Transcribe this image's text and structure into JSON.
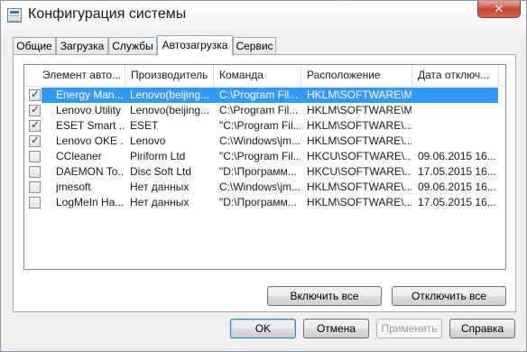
{
  "window": {
    "title": "Конфигурация системы",
    "close_glyph": "✕"
  },
  "tabs": [
    {
      "label": "Общие",
      "active": false
    },
    {
      "label": "Загрузка",
      "active": false
    },
    {
      "label": "Службы",
      "active": false
    },
    {
      "label": "Автозагрузка",
      "active": true
    },
    {
      "label": "Сервис",
      "active": false
    }
  ],
  "startup": {
    "columns": [
      "Элемент авто...",
      "Производитель",
      "Команда",
      "Расположение",
      "Дата отключ..."
    ],
    "rows": [
      {
        "checked": true,
        "selected": true,
        "item": "Energy Man...",
        "vendor": "Lenovo(beijing...",
        "command": "C:\\Program Fil...",
        "location": "HKLM\\SOFTWARE\\M...",
        "date": ""
      },
      {
        "checked": true,
        "selected": false,
        "item": "Lenovo Utility",
        "vendor": "Lenovo(beijing...",
        "command": "C:\\Program Fil...",
        "location": "HKLM\\SOFTWARE\\M...",
        "date": ""
      },
      {
        "checked": true,
        "selected": false,
        "item": "ESET Smart ...",
        "vendor": "ESET",
        "command": "\"C:\\Program Fil...",
        "location": "HKLM\\SOFTWARE\\...",
        "date": ""
      },
      {
        "checked": true,
        "selected": false,
        "item": "Lenovo OKE ...",
        "vendor": "Lenovo",
        "command": "C:\\Windows\\jm...",
        "location": "HKLM\\SOFTWARE\\...",
        "date": ""
      },
      {
        "checked": false,
        "selected": false,
        "item": "CCleaner",
        "vendor": "Piriform Ltd",
        "command": "\"C:\\Program Fil...",
        "location": "HKCU\\SOFTWARE\\...",
        "date": "09.06.2015 16..."
      },
      {
        "checked": false,
        "selected": false,
        "item": "DAEMON To...",
        "vendor": "Disc Soft Ltd",
        "command": "\"D:\\Программ...",
        "location": "HKCU\\SOFTWARE\\...",
        "date": "17.05.2015 16..."
      },
      {
        "checked": false,
        "selected": false,
        "item": "jmesoft",
        "vendor": "Нет данных",
        "command": "C:\\Windows\\jm...",
        "location": "HKLM\\SOFTWARE\\...",
        "date": "09.06.2015 16..."
      },
      {
        "checked": false,
        "selected": false,
        "item": "LogMeIn Ha...",
        "vendor": "Нет данных",
        "command": "\"D:\\Программ...",
        "location": "HKLM\\SOFTWARE\\...",
        "date": "17.05.2015 16..."
      }
    ]
  },
  "panel_buttons": {
    "enable_all": "Включить все",
    "disable_all": "Отключить все"
  },
  "dialog_buttons": {
    "ok": "OK",
    "cancel": "Отмена",
    "apply": "Применить",
    "help": "Справка"
  },
  "checkmark_glyph": "✓",
  "colors": {
    "selection": "#3399ff",
    "default_button_border": "#3c7fb1"
  }
}
